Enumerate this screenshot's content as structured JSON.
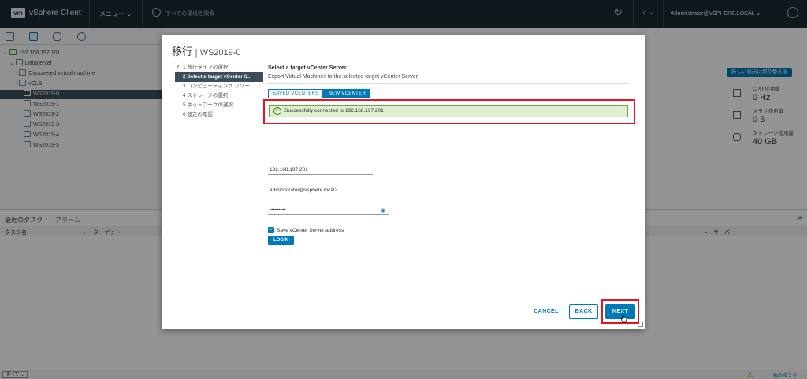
{
  "header": {
    "logo": "vm",
    "app_name": "vSphere Client",
    "menu_label": "メニュー ⌄",
    "search_placeholder": "すべての環境を検索",
    "help_label": "? ⌄",
    "user_label": "Administrator@VSPHERE.LOCAL ⌄"
  },
  "navigator": {
    "tree": [
      {
        "label": "192.168.197.101",
        "level": 0,
        "expander": "⌄"
      },
      {
        "label": "Datacenter",
        "level": 1,
        "expander": "⌄"
      },
      {
        "label": "Discovered virtual machine",
        "level": 2,
        "expander": "›"
      },
      {
        "label": "vCLS",
        "level": 2,
        "expander": "›"
      },
      {
        "label": "WS2019-0",
        "level": 2,
        "expander": "",
        "selected": true
      },
      {
        "label": "WS2019-1",
        "level": 2,
        "expander": ""
      },
      {
        "label": "WS2019-2",
        "level": 2,
        "expander": ""
      },
      {
        "label": "WS2019-3",
        "level": 2,
        "expander": ""
      },
      {
        "label": "WS2019-4",
        "level": 2,
        "expander": ""
      },
      {
        "label": "WS2019-5",
        "level": 2,
        "expander": ""
      }
    ]
  },
  "summary": {
    "switch_view_label": "新しい表示に切り替える",
    "cpu_label": "CPU 使用量",
    "cpu_value": "0 Hz",
    "mem_label": "メモリ使用量",
    "mem_value": "0 B",
    "storage_label": "ストレージ使用量",
    "storage_value": "40 GB"
  },
  "bottom_panel": {
    "tab_recent_tasks": "最近のタスク",
    "tab_alarms": "アラーム",
    "col_task_name": "タスク名",
    "col_target": "ターゲット",
    "col_server": "サーバ",
    "filter_all": "すべて ⌄",
    "more_tasks": "他のタスク"
  },
  "modal": {
    "title": "移行",
    "subtitle": "WS2019-0",
    "steps": [
      {
        "label": "1 移行タイプの選択",
        "state": "done"
      },
      {
        "label": "2 Select a target vCenter S...",
        "state": "active"
      },
      {
        "label": "3 コンピューティング リソー...",
        "state": "pending"
      },
      {
        "label": "4 ストレージの選択",
        "state": "pending"
      },
      {
        "label": "5 ネットワークの選択",
        "state": "pending"
      },
      {
        "label": "6 設定の確認",
        "state": "pending"
      }
    ],
    "content": {
      "heading": "Select a target vCenter Server",
      "description": "Export Virtual Machines to the selected target vCenter Server.",
      "toggle_saved": "SAVED VCENTERS",
      "toggle_new": "NEW VCENTER",
      "success_message": "Successfully connected to 192.168.197.201",
      "server_address": "192.168.197.201",
      "username": "administrator@vsphere.local2",
      "password_mask": "•••••••••",
      "save_address_label": "Save vCenter Server address",
      "save_address_checked": true,
      "login_label": "LOGIN"
    },
    "footer": {
      "cancel_label": "CANCEL",
      "back_label": "BACK",
      "next_label": "NEXT"
    }
  },
  "colors": {
    "accent": "#0079b8",
    "header_bg": "#1b2a32",
    "success_bg": "#dff0d0",
    "highlight": "#e8141e"
  }
}
